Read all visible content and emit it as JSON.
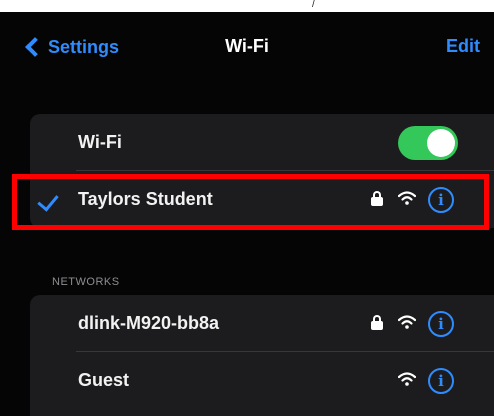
{
  "nav": {
    "back_label": "Settings",
    "title": "Wi-Fi",
    "edit_label": "Edit"
  },
  "wifi_toggle": {
    "label": "Wi-Fi",
    "enabled": true
  },
  "current_network": {
    "name": "Taylors Student",
    "connected": true,
    "secured": true
  },
  "networks_section": {
    "header": "NETWORKS",
    "items": [
      {
        "name": "dlink-M920-bb8a",
        "secured": true
      },
      {
        "name": "Guest",
        "secured": false
      }
    ]
  },
  "icons": {
    "back": "chevron-left-icon",
    "check": "checkmark-icon",
    "lock": "lock-icon",
    "wifi": "wifi-signal-icon",
    "info": "info-icon"
  },
  "colors": {
    "accent": "#2f8cff",
    "toggle_on": "#34c759",
    "highlight": "#ff0000",
    "background": "#050505",
    "cell": "#1c1c1e"
  }
}
